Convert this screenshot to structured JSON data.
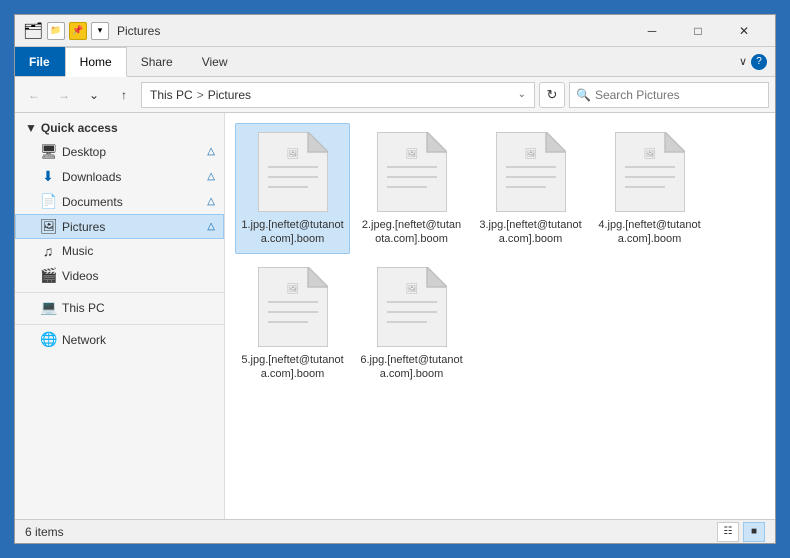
{
  "titleBar": {
    "title": "Pictures",
    "minimize": "─",
    "maximize": "□",
    "close": "✕"
  },
  "ribbon": {
    "tabs": [
      "File",
      "Home",
      "Share",
      "View"
    ],
    "activeTab": "Home"
  },
  "addressBar": {
    "back": "←",
    "forward": "→",
    "dropdown": "∨",
    "up": "↑",
    "path": [
      "This PC",
      "Pictures"
    ],
    "pathDropdown": "∨",
    "refresh": "↻",
    "searchPlaceholder": "Search Pictures"
  },
  "sidebar": {
    "quickAccess": {
      "label": "Quick access",
      "items": [
        {
          "icon": "🖥",
          "label": "Desktop",
          "pinned": true
        },
        {
          "icon": "⬇",
          "label": "Downloads",
          "pinned": true
        },
        {
          "icon": "📄",
          "label": "Documents",
          "pinned": true
        },
        {
          "icon": "🖼",
          "label": "Pictures",
          "pinned": true,
          "active": true
        },
        {
          "icon": "♪",
          "label": "Music",
          "pinned": false
        },
        {
          "icon": "🎬",
          "label": "Videos",
          "pinned": false
        }
      ]
    },
    "thisPC": {
      "icon": "💻",
      "label": "This PC"
    },
    "network": {
      "icon": "🌐",
      "label": "Network"
    }
  },
  "files": [
    {
      "name": "1.jpg.[neftet@tutanota.com].boom",
      "selected": true
    },
    {
      "name": "2.jpeg.[neftet@tutanota.com].boom"
    },
    {
      "name": "3.jpg.[neftet@tutanota.com].boom"
    },
    {
      "name": "4.jpg.[neftet@tutanota.com].boom"
    },
    {
      "name": "5.jpg.[neftet@tutanota.com].boom"
    },
    {
      "name": "6.jpg.[neftet@tutanota.com].boom"
    }
  ],
  "statusBar": {
    "count": "6 items"
  }
}
